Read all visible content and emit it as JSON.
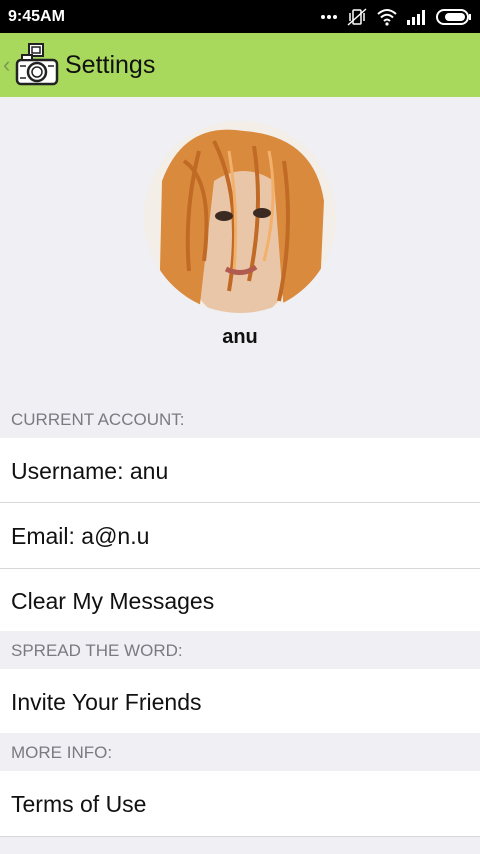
{
  "status_bar": {
    "time": "9:45AM",
    "icons": [
      "more-dots-icon",
      "mute-vibrate-icon",
      "wifi-icon",
      "signal-icon",
      "battery-icon"
    ],
    "bg_color": "#000000"
  },
  "app_bar": {
    "title": "Settings",
    "back_icon": "chevron-left-icon",
    "logo_icon": "camera-logo-icon",
    "bg_color": "#a8d85c"
  },
  "profile": {
    "name": "anu",
    "avatar_icon": "profile-photo"
  },
  "sections": {
    "current_account": {
      "header": "CURRENT ACCOUNT:",
      "username": "Username: anu",
      "email": "Email: a@n.u",
      "clear_messages": "Clear My Messages"
    },
    "spread_the_word": {
      "header": "SPREAD THE WORD:",
      "invite": "Invite Your Friends"
    },
    "more_info": {
      "header": "MORE INFO:",
      "terms": "Terms of Use"
    }
  }
}
